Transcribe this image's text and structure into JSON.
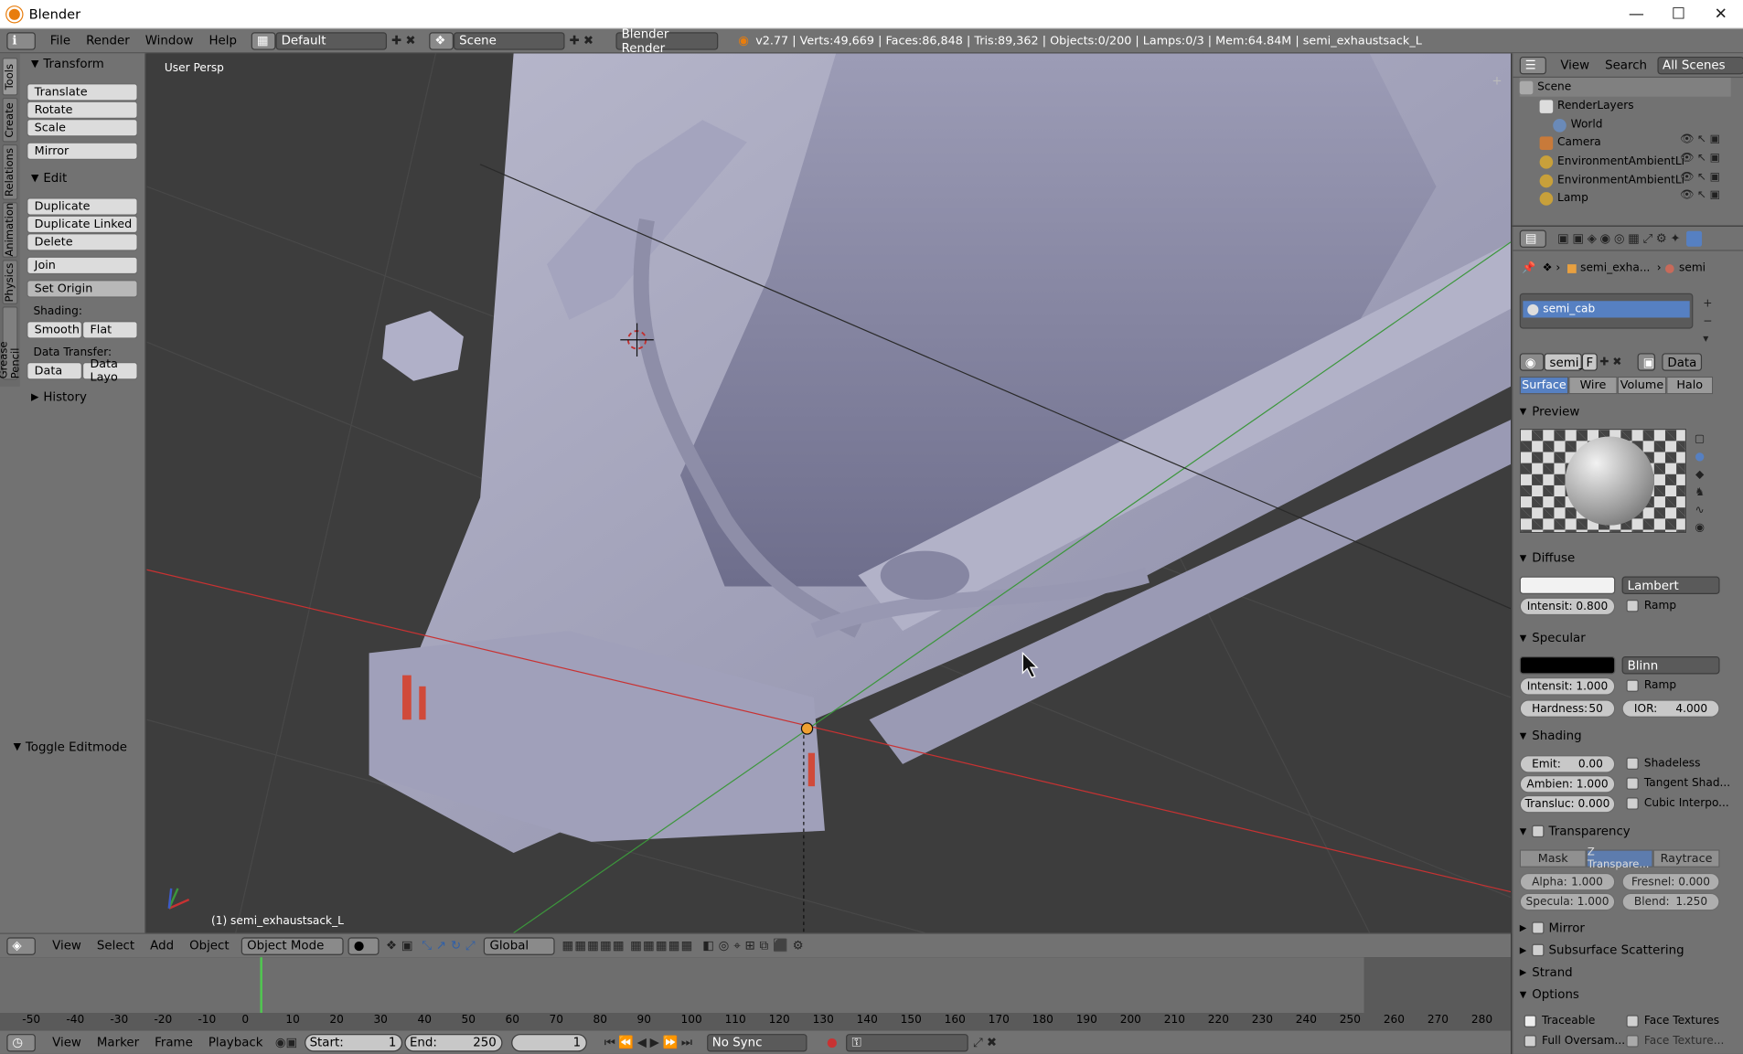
{
  "window": {
    "title": "Blender",
    "minimize": "—",
    "maximize": "☐",
    "close": "✕"
  },
  "info": {
    "menus": [
      "File",
      "Render",
      "Window",
      "Help"
    ],
    "layout": "Default",
    "scene": "Scene",
    "engine": "Blender Render",
    "stats": "v2.77 | Verts:49,669 | Faces:86,848 | Tris:89,362 | Objects:0/200 | Lamps:0/3 | Mem:64.84M | semi_exhaustsack_L"
  },
  "tool_tabs": [
    "Tools",
    "Create",
    "Relations",
    "Animation",
    "Physics",
    "Grease Pencil"
  ],
  "tools": {
    "transform_title": "Transform",
    "translate": "Translate",
    "rotate": "Rotate",
    "scale": "Scale",
    "mirror": "Mirror",
    "edit_title": "Edit",
    "duplicate": "Duplicate",
    "duplicate_linked": "Duplicate Linked",
    "delete": "Delete",
    "join": "Join",
    "set_origin": "Set Origin",
    "shading_label": "Shading:",
    "smooth": "Smooth",
    "flat": "Flat",
    "data_transfer_label": "Data Transfer:",
    "data": "Data",
    "data_layo": "Data Layo",
    "history": "History",
    "toggle_editmode": "Toggle Editmode"
  },
  "viewport": {
    "persp_label": "User Persp",
    "object_label": "(1) semi_exhaustsack_L"
  },
  "view_header": {
    "menus": [
      "View",
      "Select",
      "Add",
      "Object"
    ],
    "mode": "Object Mode",
    "orientation": "Global"
  },
  "timeline": {
    "ticks": [
      "-50",
      "-40",
      "-30",
      "-20",
      "-10",
      "0",
      "10",
      "20",
      "30",
      "40",
      "50",
      "60",
      "70",
      "80",
      "90",
      "100",
      "110",
      "120",
      "130",
      "140",
      "150",
      "160",
      "170",
      "180",
      "190",
      "200",
      "210",
      "220",
      "230",
      "240",
      "250",
      "260",
      "270",
      "280"
    ],
    "menus": [
      "View",
      "Marker",
      "Frame",
      "Playback"
    ],
    "start_label": "Start:",
    "start": "1",
    "end_label": "End:",
    "end": "250",
    "current": "1",
    "sync": "No Sync",
    "current_frame": 0
  },
  "outliner": {
    "view": "View",
    "search": "Search",
    "filter": "All Scenes",
    "items": [
      "Scene",
      "RenderLayers",
      "World",
      "Camera",
      "EnvironmentAmbientLi",
      "EnvironmentAmbientLi",
      "Lamp"
    ]
  },
  "properties": {
    "crumb_object": "semi_exha...",
    "crumb_material": "semi",
    "material_slot": "semi_cab",
    "mat_name": "semi_c",
    "mat_f": "F",
    "link": "Data",
    "tabs": [
      "Surface",
      "Wire",
      "Volume",
      "Halo"
    ],
    "preview": "Preview",
    "diffuse": "Diffuse",
    "diffuse_shader": "Lambert",
    "diffuse_intensity": "Intensit: 0.800",
    "ramp": "Ramp",
    "specular": "Specular",
    "specular_shader": "Blinn",
    "specular_intensity": "Intensit: 1.000",
    "hardness": "Hardness:",
    "hardness_val": "50",
    "ior": "IOR:",
    "ior_val": "4.000",
    "shading": "Shading",
    "emit": "Emit:",
    "emit_val": "0.00",
    "shadeless": "Shadeless",
    "ambient": "Ambien: 1.000",
    "tangent": "Tangent Shad...",
    "transluc": "Transluc: 0.000",
    "cubic": "Cubic Interpo...",
    "transparency": "Transparency",
    "mask": "Mask",
    "ztransp": "Z Transpare...",
    "raytrace": "Raytrace",
    "alpha": "Alpha:",
    "alpha_val": "1.000",
    "fresnel": "Fresnel: 0.000",
    "specular_t": "Specula: 1.000",
    "blend": "Blend:",
    "blend_val": "1.250",
    "mirror": "Mirror",
    "sss": "Subsurface Scattering",
    "strand": "Strand",
    "options": "Options",
    "traceable": "Traceable",
    "face_textures": "Face Textures",
    "full_oversam": "Full Oversam...",
    "face_texture_alpha": "Face Texture..."
  },
  "colors": {
    "accent": "#5680c2",
    "panel": "#727272",
    "viewport": "#3d3d3d",
    "xaxis": "#c83232",
    "yaxis": "#3c963c"
  }
}
